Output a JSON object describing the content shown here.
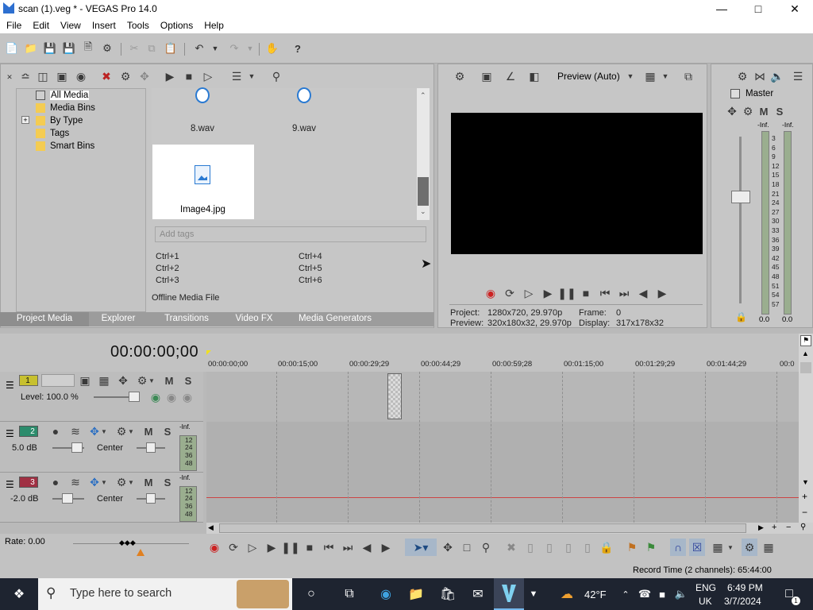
{
  "window": {
    "title": "scan (1).veg * - VEGAS Pro 14.0",
    "min": "—",
    "max": "□",
    "close": "✕"
  },
  "menu": [
    "File",
    "Edit",
    "View",
    "Insert",
    "Tools",
    "Options",
    "Help"
  ],
  "project_media": {
    "tree": [
      "All Media",
      "Media Bins",
      "By Type",
      "Tags",
      "Smart Bins"
    ],
    "expander": "+",
    "files": [
      "8.wav",
      "9.wav",
      "Image4.jpg"
    ],
    "tags_placeholder": "Add tags",
    "shortcuts": [
      "Ctrl+1",
      "Ctrl+2",
      "Ctrl+3",
      "Ctrl+4",
      "Ctrl+5",
      "Ctrl+6"
    ],
    "status": "Offline Media File",
    "tabs": [
      "Project Media",
      "Explorer",
      "Transitions",
      "Video FX",
      "Media Generators"
    ]
  },
  "preview": {
    "mode": "Preview (Auto)",
    "project_label": "Project:",
    "project_value": "1280x720, 29.970p",
    "preview_label": "Preview:",
    "preview_value": "320x180x32, 29.970p",
    "frame_label": "Frame:",
    "frame_value": "0",
    "display_label": "Display:",
    "display_value": "317x178x32"
  },
  "master": {
    "label": "Master",
    "m": "M",
    "s": "S",
    "inf_left": "-Inf.",
    "inf_right": "-Inf.",
    "scale": [
      "3",
      "6",
      "9",
      "12",
      "15",
      "18",
      "21",
      "24",
      "27",
      "30",
      "33",
      "36",
      "39",
      "42",
      "45",
      "48",
      "51",
      "54",
      "57"
    ],
    "foot_left": "0.0",
    "foot_right": "0.0"
  },
  "timeline": {
    "timecode": "00:00:00;00",
    "ruler": [
      "00:00:00;00",
      "00:00:15;00",
      "00:00:29;29",
      "00:00:44;29",
      "00:00:59;28",
      "00:01:15;00",
      "00:01:29;29",
      "00:01:44;29",
      "00:0"
    ],
    "tracks": [
      {
        "num": "1",
        "level": "Level: 100.0 %",
        "m": "M",
        "s": "S",
        "color": "#c7c02e"
      },
      {
        "num": "2",
        "vol": "5.0 dB",
        "pan": "Center",
        "m": "M",
        "s": "S",
        "inf": "-Inf.",
        "color": "#2c8c6c"
      },
      {
        "num": "3",
        "vol": "-2.0 dB",
        "pan": "Center",
        "m": "M",
        "s": "S",
        "inf": "-Inf.",
        "color": "#a03043"
      }
    ],
    "mini_scale": [
      "12",
      "24",
      "36",
      "48"
    ],
    "rate": "Rate: 0.00",
    "record_time": "Record Time (2 channels): 65:44:00"
  },
  "taskbar": {
    "search_placeholder": "Type here to search",
    "weather": "42°F",
    "lang1": "ENG",
    "lang2": "UK",
    "time": "6:49 PM",
    "date": "3/7/2024",
    "notif_count": "1"
  }
}
